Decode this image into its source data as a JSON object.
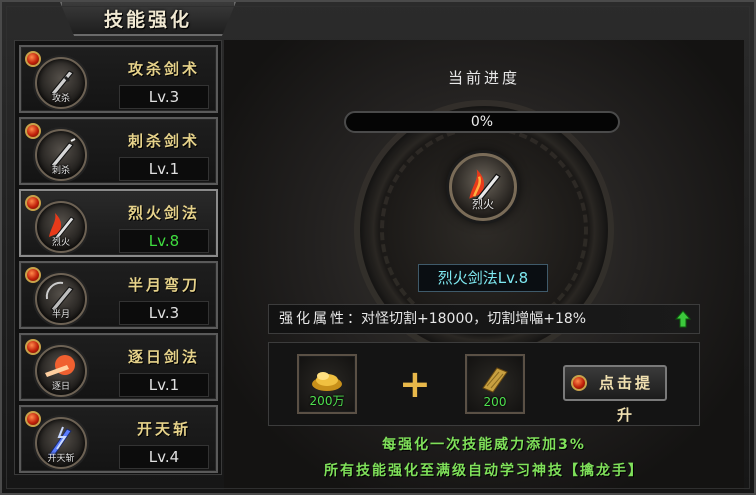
{
  "window": {
    "title": "技能强化"
  },
  "sidebar": {
    "items": [
      {
        "name": "攻杀剑术",
        "level": "Lv.3",
        "icon_caption": "攻杀",
        "icon": "sword-icon",
        "selected": false
      },
      {
        "name": "刺杀剑术",
        "level": "Lv.1",
        "icon_caption": "刺杀",
        "icon": "sword-icon",
        "selected": false
      },
      {
        "name": "烈火剑法",
        "level": "Lv.8",
        "icon_caption": "烈火",
        "icon": "flame-sword-icon",
        "selected": true
      },
      {
        "name": "半月弯刀",
        "level": "Lv.3",
        "icon_caption": "半月",
        "icon": "sword-icon",
        "selected": false
      },
      {
        "name": "逐日剑法",
        "level": "Lv.1",
        "icon_caption": "逐日",
        "icon": "sun-sword-icon",
        "selected": false
      },
      {
        "name": "开天斩",
        "level": "Lv.4",
        "icon_caption": "开天斩",
        "icon": "lightning-sword-icon",
        "selected": false
      }
    ]
  },
  "main": {
    "progress_title": "当前进度",
    "progress_value": 0,
    "progress_text": "0%",
    "current_skill_caption": "烈火",
    "current_skill_label": "烈火剑法Lv.8",
    "attribute_label": "强化属性",
    "attribute_value": "对怪切割+18000，切割增幅+18%",
    "cost": {
      "gold_count": "200万",
      "material_count": "200"
    },
    "upgrade_button": "点击提升",
    "note_line1": "每强化一次技能威力添加3%",
    "note_line2": "所有技能强化至满级自动学习神技【擒龙手】"
  },
  "colors": {
    "level_active": "#3fdc3f",
    "skill_label": "#7ee8f0",
    "note": "#7fe05a"
  }
}
